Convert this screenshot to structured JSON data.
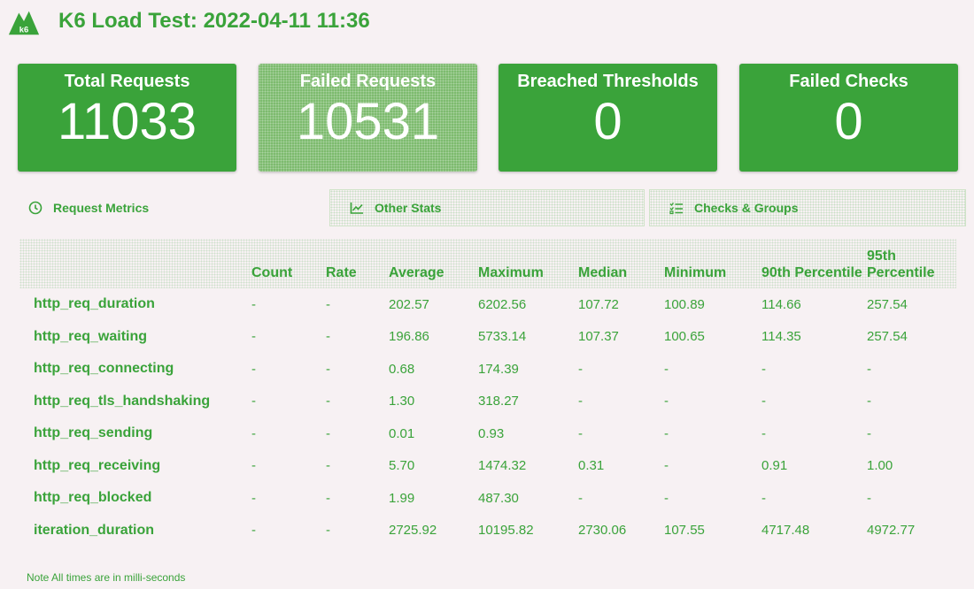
{
  "header": {
    "title": "K6 Load Test: 2022-04-11 11:36",
    "logo_text": "k6"
  },
  "cards": [
    {
      "label": "Total Requests",
      "value": "11033"
    },
    {
      "label": "Failed Requests",
      "value": "10531"
    },
    {
      "label": "Breached Thresholds",
      "value": "0"
    },
    {
      "label": "Failed Checks",
      "value": "0"
    }
  ],
  "tabs": [
    {
      "label": "Request Metrics",
      "icon": "clock-icon"
    },
    {
      "label": "Other Stats",
      "icon": "chart-line-icon"
    },
    {
      "label": "Checks & Groups",
      "icon": "checklist-icon"
    }
  ],
  "table": {
    "headers": [
      "",
      "Count",
      "Rate",
      "Average",
      "Maximum",
      "Median",
      "Minimum",
      "90th Percentile",
      "95th Percentile"
    ],
    "rows": [
      [
        "http_req_duration",
        "-",
        "-",
        "202.57",
        "6202.56",
        "107.72",
        "100.89",
        "114.66",
        "257.54"
      ],
      [
        "http_req_waiting",
        "-",
        "-",
        "196.86",
        "5733.14",
        "107.37",
        "100.65",
        "114.35",
        "257.54"
      ],
      [
        "http_req_connecting",
        "-",
        "-",
        "0.68",
        "174.39",
        "-",
        "-",
        "-",
        "-"
      ],
      [
        "http_req_tls_handshaking",
        "-",
        "-",
        "1.30",
        "318.27",
        "-",
        "-",
        "-",
        "-"
      ],
      [
        "http_req_sending",
        "-",
        "-",
        "0.01",
        "0.93",
        "-",
        "-",
        "-",
        "-"
      ],
      [
        "http_req_receiving",
        "-",
        "-",
        "5.70",
        "1474.32",
        "0.31",
        "-",
        "0.91",
        "1.00"
      ],
      [
        "http_req_blocked",
        "-",
        "-",
        "1.99",
        "487.30",
        "-",
        "-",
        "-",
        "-"
      ],
      [
        "iteration_duration",
        "-",
        "-",
        "2725.92",
        "10195.82",
        "2730.06",
        "107.55",
        "4717.48",
        "4972.77"
      ]
    ]
  },
  "note": "Note  All times are in milli-seconds",
  "colors": {
    "accent": "#3aa33a",
    "background": "#f7f1f3",
    "card_faded": "#7dbb6e"
  }
}
